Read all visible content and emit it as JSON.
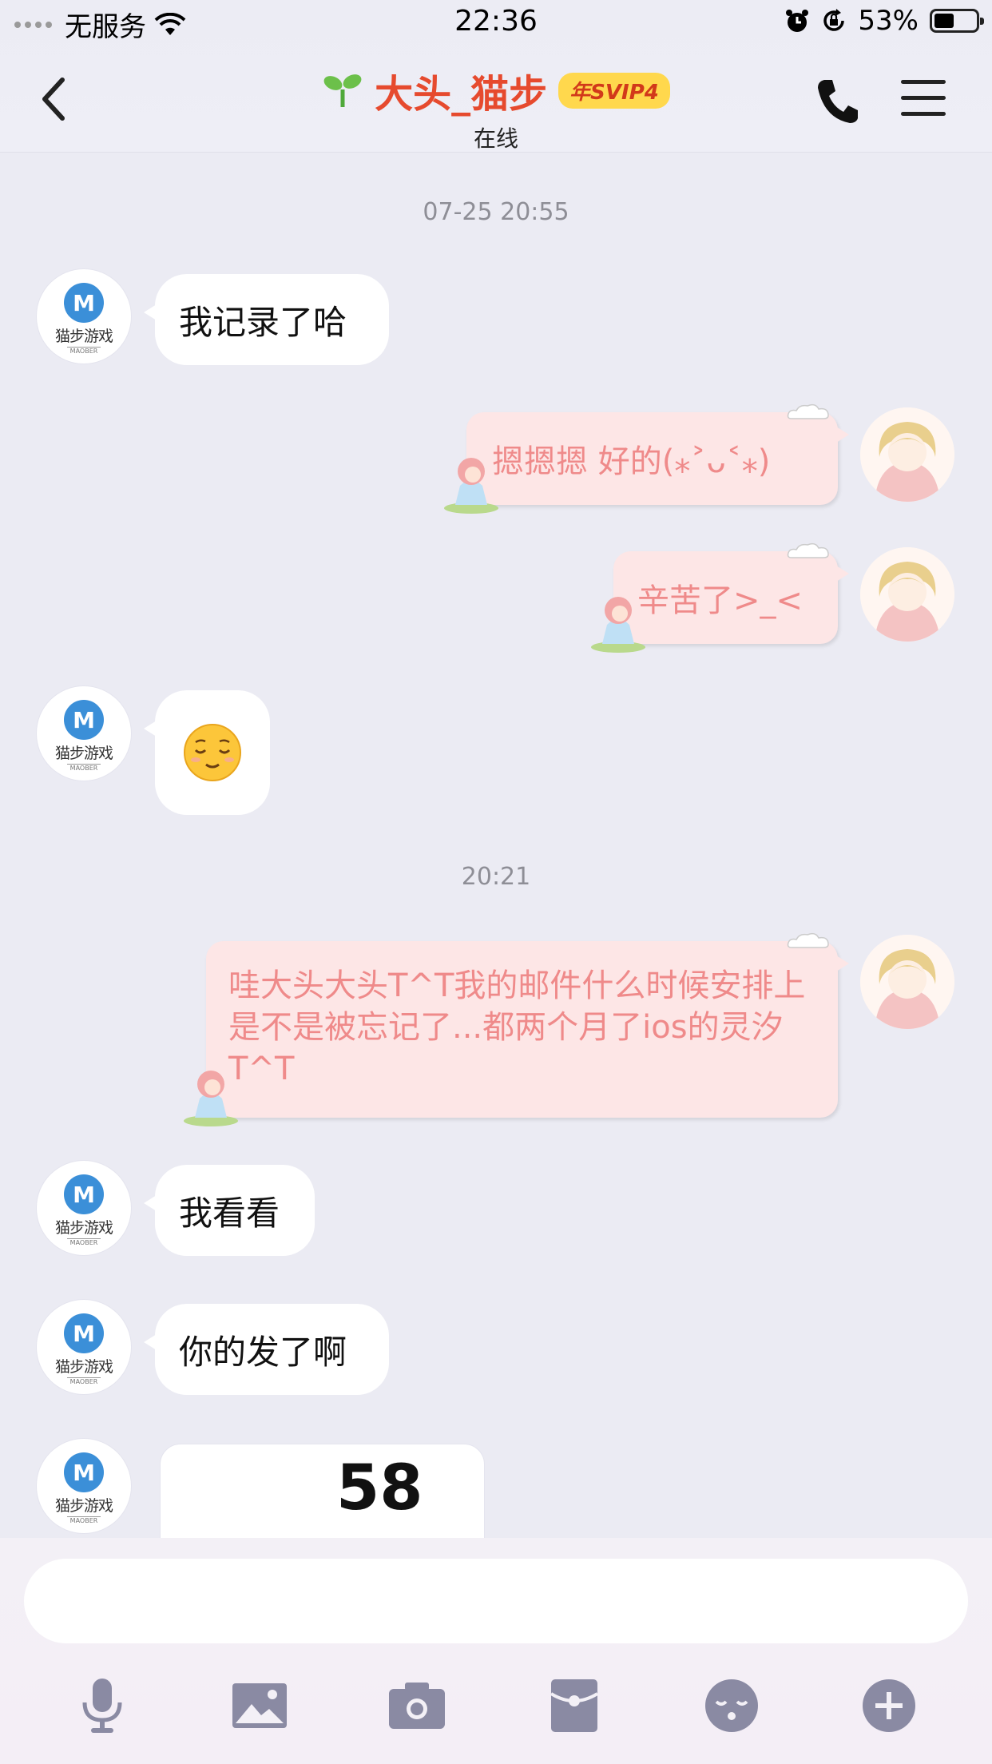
{
  "status_bar": {
    "carrier": "无服务",
    "time": "22:36",
    "battery": "53%",
    "battery_level": 0.53
  },
  "header": {
    "title": "大头_猫步",
    "badge": "年SVIP4",
    "subtitle": "在线"
  },
  "chat": {
    "ts1": "07-25 20:55",
    "m1": "我记录了哈",
    "m2": "摁摁摁 好的(⁎˃ᴗ˂⁎)",
    "m3": "辛苦了>_<",
    "m4": "😌",
    "ts2": "20:21",
    "m5": "哇大头大头T^T我的邮件什么时候安排上 是不是被忘记了...都两个月了ios的灵汐T^T",
    "m6": "我看看",
    "m7": "你的发了啊",
    "m8": "58"
  },
  "avatar": {
    "brand_mark": "M",
    "brand_text": "猫步游戏",
    "brand_sub": "MAOBER"
  },
  "input": {
    "value": ""
  },
  "icons": [
    "microphone-icon",
    "image-icon",
    "camera-icon",
    "red-envelope-icon",
    "emoji-icon",
    "plus-icon"
  ],
  "colors": {
    "title": "#e64a2e",
    "out_bubble": "#fde6e6",
    "out_text": "#ef8a8a",
    "svip_badge": "#ffd84d"
  }
}
